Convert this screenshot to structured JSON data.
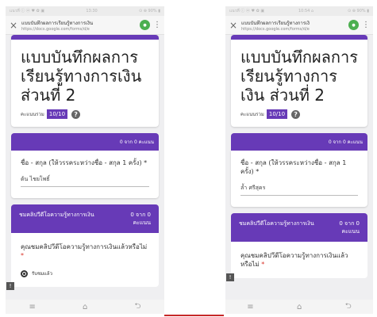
{
  "phones": [
    {
      "status_left": "แนวที่ ⓘ ⓦ ♥ ✿ ▣",
      "status_center": "13:30",
      "status_right": "⊙ ⊕ 90% ▮",
      "tab_title": "แบบบันทึกผลการเรียนรู้ทางการเงิน",
      "url": "https://docs.google.com/forms/d/e",
      "title": "แบบบันทึกผลการเรียนรู้ทางการเงิน ส่วนที่ 2",
      "score_label": "คะแนนรวม",
      "score": "10/10",
      "points_header": "0 จาก 0 คะแนน",
      "q1": "ชื่อ - สกุล (ให้วรรคระหว่างชื่อ - สกุล 1 ครั้ง) *",
      "a1": "ต้น ไชยโพธิ์",
      "section_title": "ชมคลิปวีดีโอความรู้ทางการเงิน",
      "section_points": "0 จาก 0 คะแนน",
      "q2": "คุณชมคลิปวีดีโอความรู้ทางการเงินแล้วหรือไม่",
      "radio": "รับชมแล้ว"
    },
    {
      "status_left": "แนวที่ ⓘ ⓦ ♥ ✿ ▣",
      "status_center": "10:54 ⌂",
      "status_right": "⊙ ⊕ 90% ▮",
      "tab_title": "แบบบันทึกผลการเรียนรู้ทางการเงิ",
      "url": "https://docs.google.com/forms/d/e",
      "title": "แบบบันทึกผลการเรียนรู้ทางการเงิน ส่วนที่ 2",
      "score_label": "คะแนนรวม",
      "score": "10/10",
      "points_header": "0 จาก 0 คะแนน",
      "q1": "ชื่อ - สกุล (ให้วรรคระหว่างชื่อ - สกุล 1 ครั้ง) *",
      "a1": "ล้ำ ศรีสุคร",
      "section_title": "ชมคลิปวีดีโอความรู้ทางการเงิน",
      "section_points": "0 จาก 0 คะแนน",
      "q2": "คุณชมคลิปวีดีโอความรู้ทางการเงินแล้วหรือไม่",
      "radio": ""
    }
  ],
  "icons": {
    "close": "×",
    "menu": "⋮",
    "nav_menu": "≡",
    "nav_home": "⌂",
    "nav_back": "⮌"
  },
  "colors": {
    "accent": "#673ab7",
    "divider": "#c62828"
  }
}
